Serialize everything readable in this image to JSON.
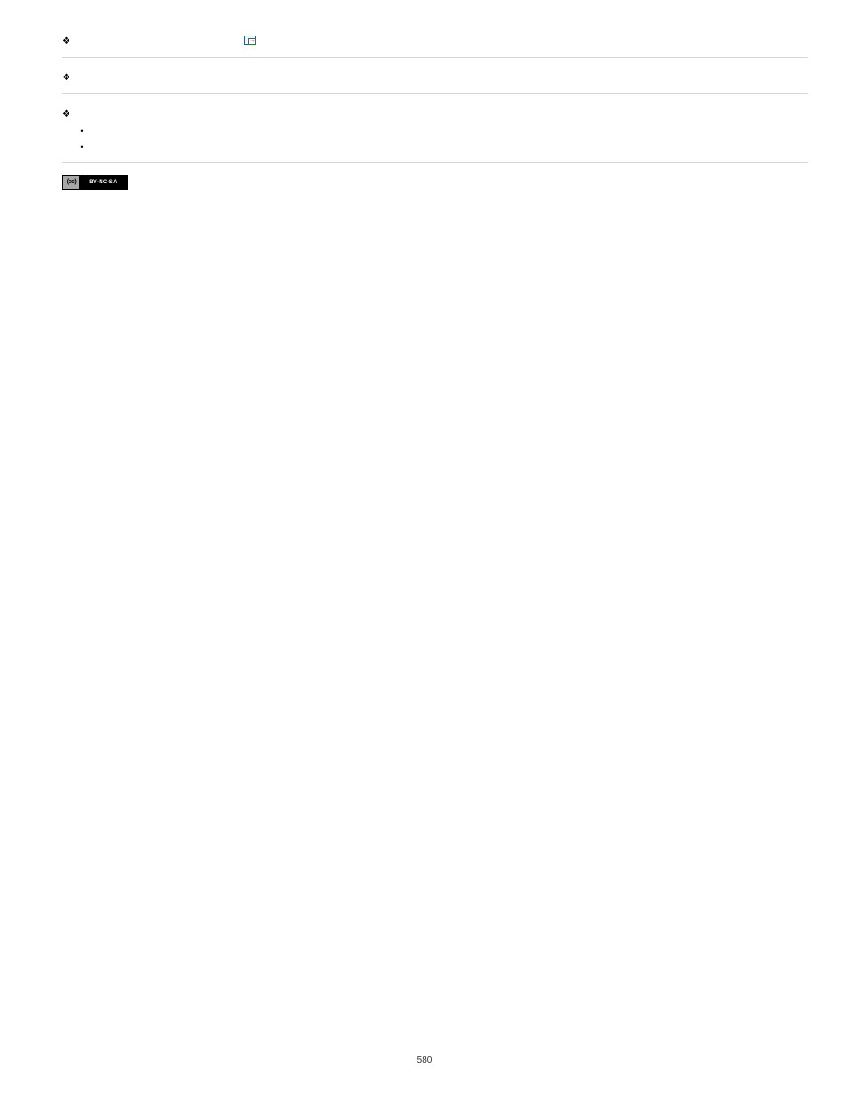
{
  "sections": [
    {
      "type": "diamond",
      "label": "",
      "hasIcon": true
    },
    {
      "type": "diamond",
      "label": "",
      "hasIcon": false
    },
    {
      "type": "diamond",
      "label": "",
      "hasIcon": false
    }
  ],
  "subitems": [
    {
      "label": ""
    },
    {
      "label": ""
    }
  ],
  "ccBadge": {
    "left": "(cc)",
    "right": "BY-NC-SA"
  },
  "pageNumber": "580"
}
